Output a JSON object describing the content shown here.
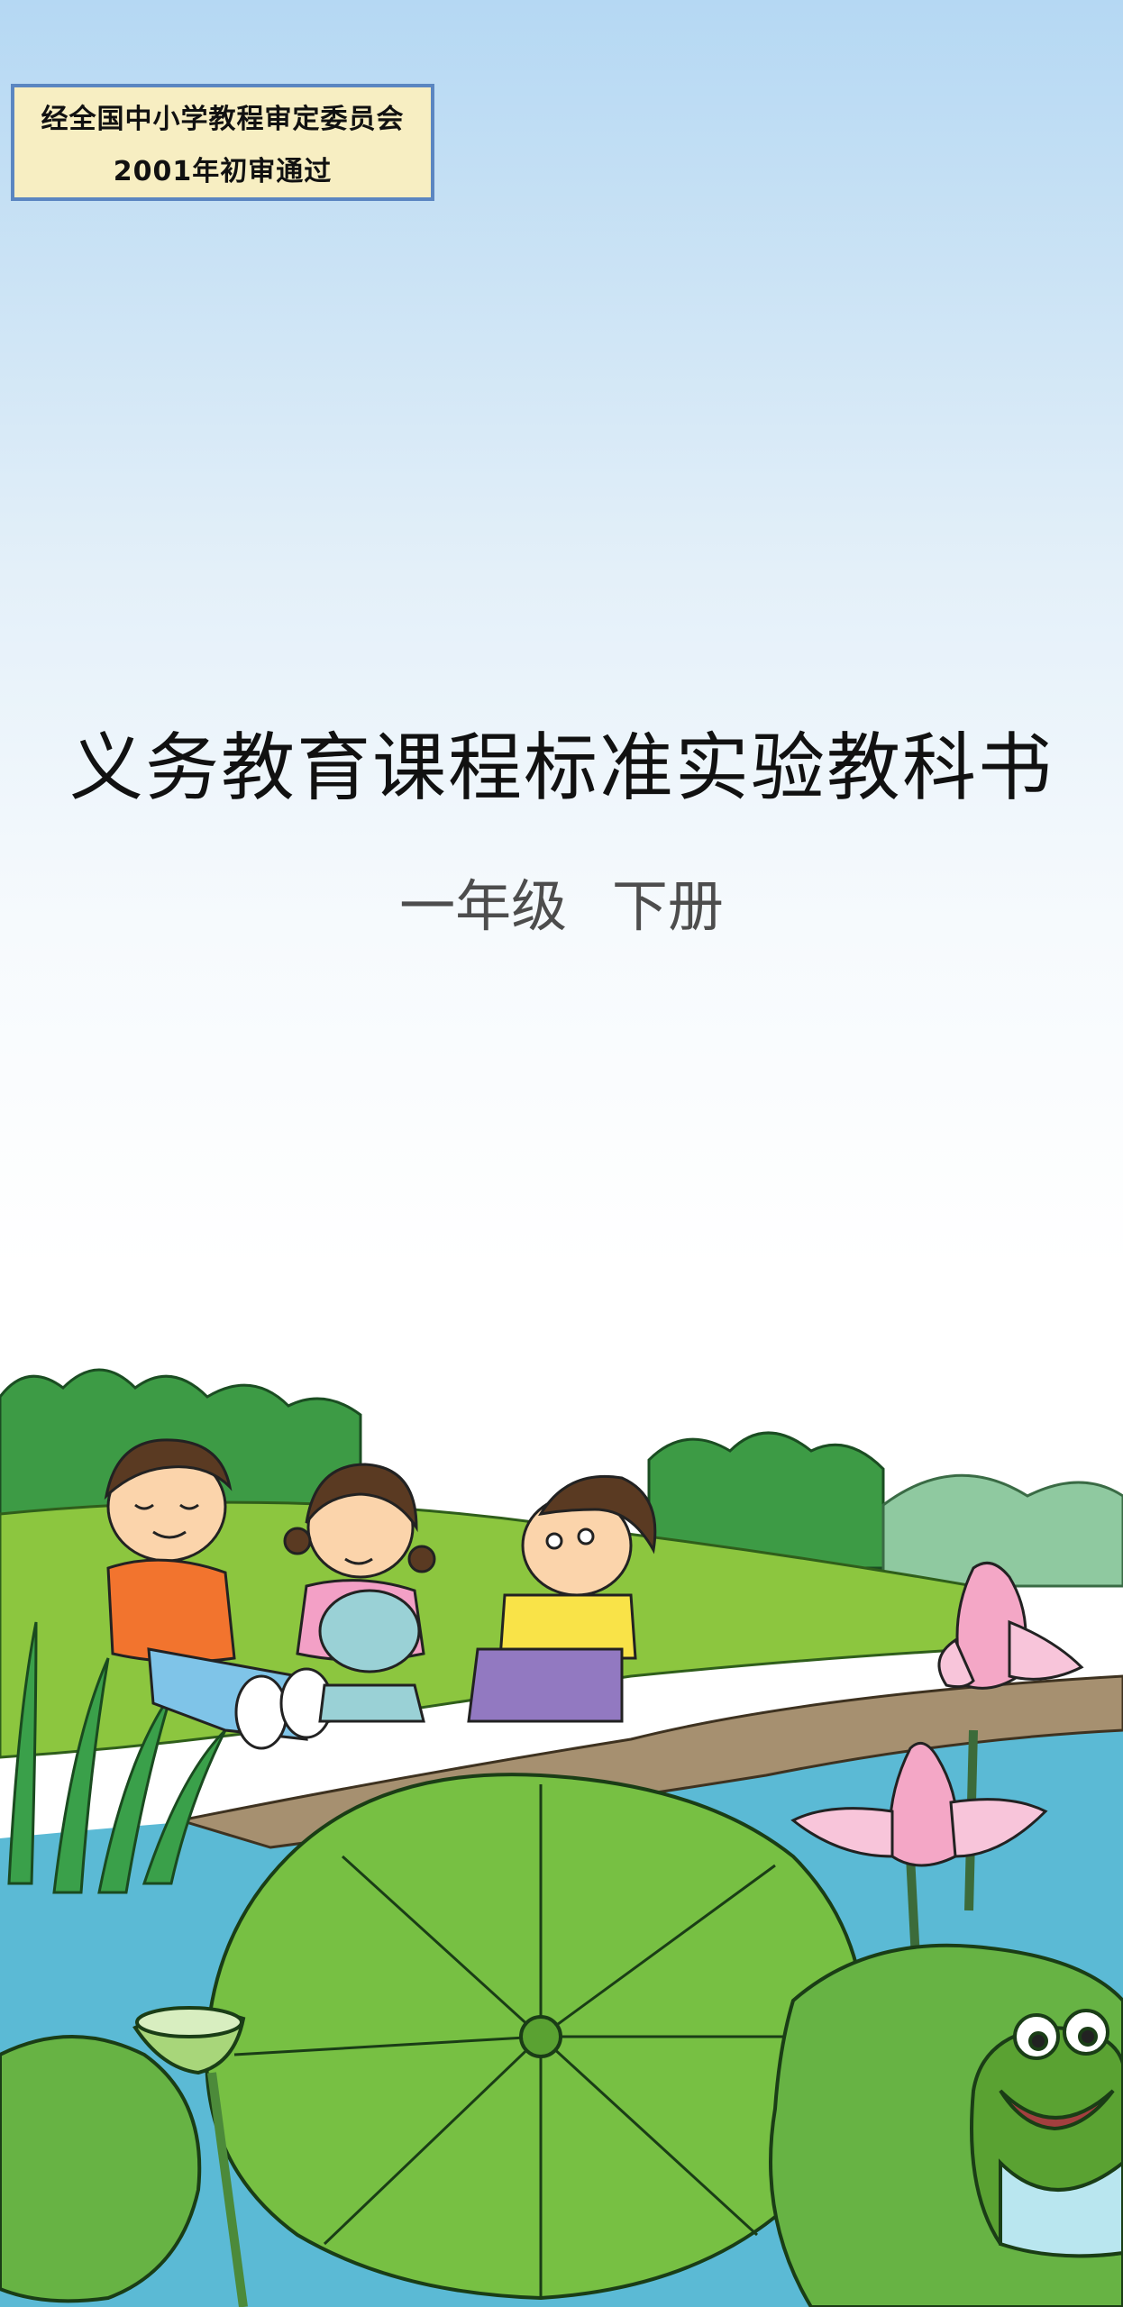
{
  "approval": {
    "line1": "经全国中小学教程审定委员会",
    "line2": "2001年初审通过"
  },
  "title": "义务教育课程标准实验教科书",
  "grade": "一年级  下册",
  "colors": {
    "sky_top": "#b5d8f3",
    "approval_bg": "#f7eec2",
    "approval_border": "#5b86c1",
    "grass": "#8cc63f",
    "water": "#5bbad5",
    "lotus_leaf": "#77c043",
    "lotus_flower": "#f4a7c6"
  },
  "illustration": {
    "icons": [
      "boy-orange-shirt-icon",
      "girl-pink-shirt-icon",
      "boy-yellow-shirt-icon",
      "lotus-flower-icon",
      "lotus-leaf-icon",
      "lotus-seedpod-icon",
      "frog-icon"
    ]
  }
}
